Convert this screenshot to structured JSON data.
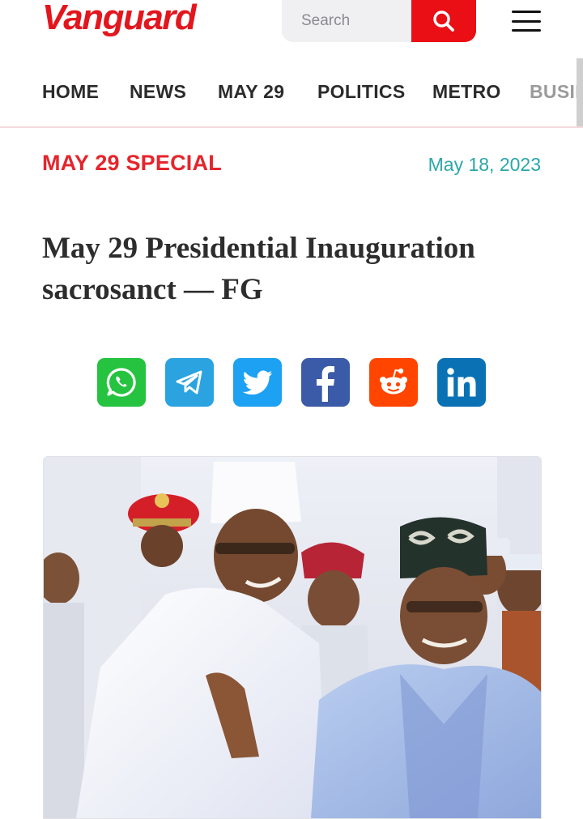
{
  "header": {
    "logo_text": "Vanguard",
    "search": {
      "placeholder": "Search",
      "icon": "search-icon"
    },
    "menu_icon": "hamburger-menu-icon"
  },
  "nav": {
    "items": [
      {
        "label": "HOME"
      },
      {
        "label": "NEWS"
      },
      {
        "label": "MAY 29"
      },
      {
        "label": "POLITICS"
      },
      {
        "label": "METRO"
      },
      {
        "label": "BUSIN"
      }
    ]
  },
  "article": {
    "category": "MAY 29 SPECIAL",
    "date": "May 18, 2023",
    "title_line1": "May 29 Presidential Inauguration",
    "title_line2": "sacrosanct — FG"
  },
  "share": [
    {
      "name": "whatsapp",
      "icon": "whatsapp-icon",
      "color": "#25c33f"
    },
    {
      "name": "telegram",
      "icon": "telegram-icon",
      "color": "#2aa3e0"
    },
    {
      "name": "twitter",
      "icon": "twitter-icon",
      "color": "#1da1f2"
    },
    {
      "name": "facebook",
      "icon": "facebook-icon",
      "color": "#3b5ba8"
    },
    {
      "name": "reddit",
      "icon": "reddit-icon",
      "color": "#ff4500"
    },
    {
      "name": "linkedin",
      "icon": "linkedin-icon",
      "color": "#0a72b4"
    }
  ],
  "colors": {
    "brand_red": "#e3161e",
    "category_red": "#e5252c",
    "date_teal": "#2aa7a9"
  }
}
